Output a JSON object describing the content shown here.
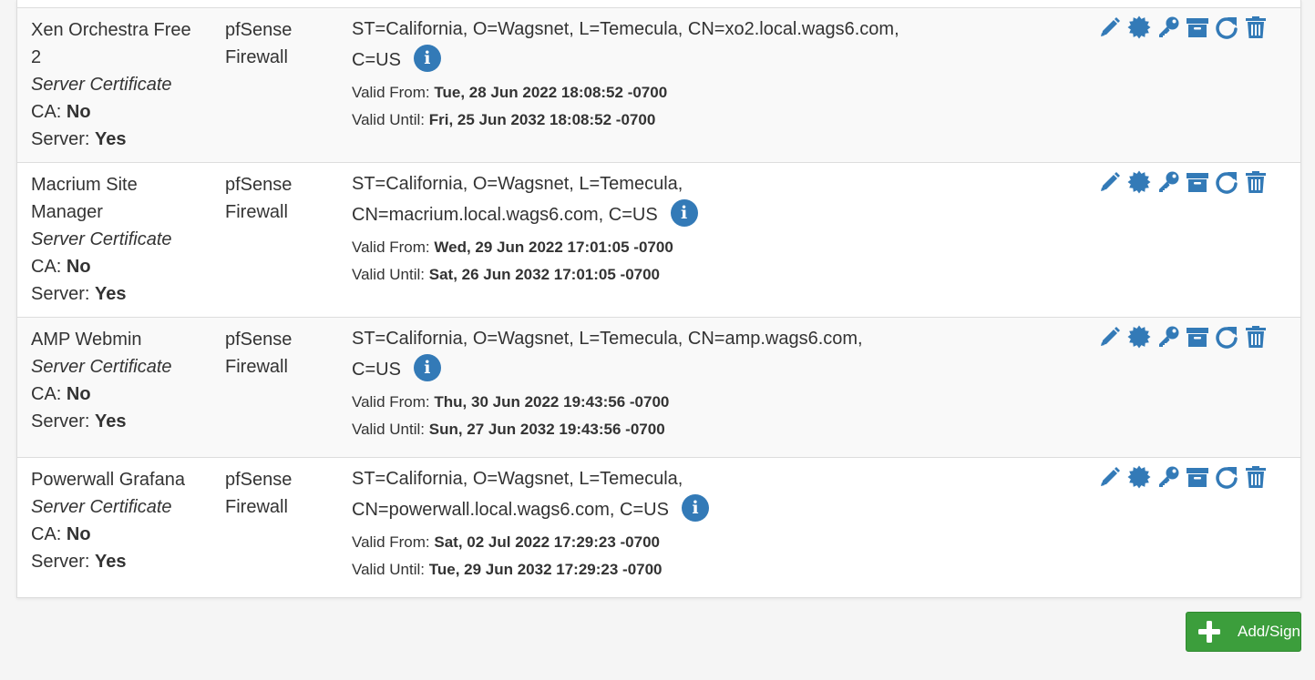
{
  "certificates": [
    {
      "name": "Xen Orchestra Free 2",
      "type": "Server Certificate",
      "ca_label": "CA:",
      "ca_value": "No",
      "server_label": "Server:",
      "server_value": "Yes",
      "issuer": "pfSense Firewall",
      "dn_line1": "ST=California, O=Wagsnet, L=Temecula, CN=xo2.local.wags6.com,",
      "dn_line2": "C=US",
      "valid_from_label": "Valid From:",
      "valid_from": "Tue, 28 Jun 2022 18:08:52 -0700",
      "valid_until_label": "Valid Until:",
      "valid_until": "Fri, 25 Jun 2032 18:08:52 -0700"
    },
    {
      "name": "Macrium Site Manager",
      "type": "Server Certificate",
      "ca_label": "CA:",
      "ca_value": "No",
      "server_label": "Server:",
      "server_value": "Yes",
      "issuer": "pfSense Firewall",
      "dn_line1": "ST=California, O=Wagsnet, L=Temecula,",
      "dn_line2": "CN=macrium.local.wags6.com, C=US",
      "valid_from_label": "Valid From:",
      "valid_from": "Wed, 29 Jun 2022 17:01:05 -0700",
      "valid_until_label": "Valid Until:",
      "valid_until": "Sat, 26 Jun 2032 17:01:05 -0700"
    },
    {
      "name": "AMP Webmin",
      "type": "Server Certificate",
      "ca_label": "CA:",
      "ca_value": "No",
      "server_label": "Server:",
      "server_value": "Yes",
      "issuer": "pfSense Firewall",
      "dn_line1": "ST=California, O=Wagsnet, L=Temecula, CN=amp.wags6.com,",
      "dn_line2": "C=US",
      "valid_from_label": "Valid From:",
      "valid_from": "Thu, 30 Jun 2022 19:43:56 -0700",
      "valid_until_label": "Valid Until:",
      "valid_until": "Sun, 27 Jun 2032 19:43:56 -0700"
    },
    {
      "name": "Powerwall Grafana",
      "type": "Server Certificate",
      "ca_label": "CA:",
      "ca_value": "No",
      "server_label": "Server:",
      "server_value": "Yes",
      "issuer": "pfSense Firewall",
      "dn_line1": "ST=California, O=Wagsnet, L=Temecula,",
      "dn_line2": "CN=powerwall.local.wags6.com, C=US",
      "valid_from_label": "Valid From:",
      "valid_from": "Sat, 02 Jul 2022 17:29:23 -0700",
      "valid_until_label": "Valid Until:",
      "valid_until": "Tue, 29 Jun 2032 17:29:23 -0700"
    }
  ],
  "info_glyph": "i",
  "action_icons": [
    "pencil-icon",
    "certificate-icon",
    "key-icon",
    "archive-icon",
    "refresh-icon",
    "trash-icon"
  ],
  "add_button": {
    "label": "Add/Sign",
    "icon": "plus-icon",
    "color": "#3c9e3c"
  },
  "colors": {
    "icon_blue": "#337ab7",
    "row_alt": "#f9f9f9",
    "border": "#dddddd"
  }
}
